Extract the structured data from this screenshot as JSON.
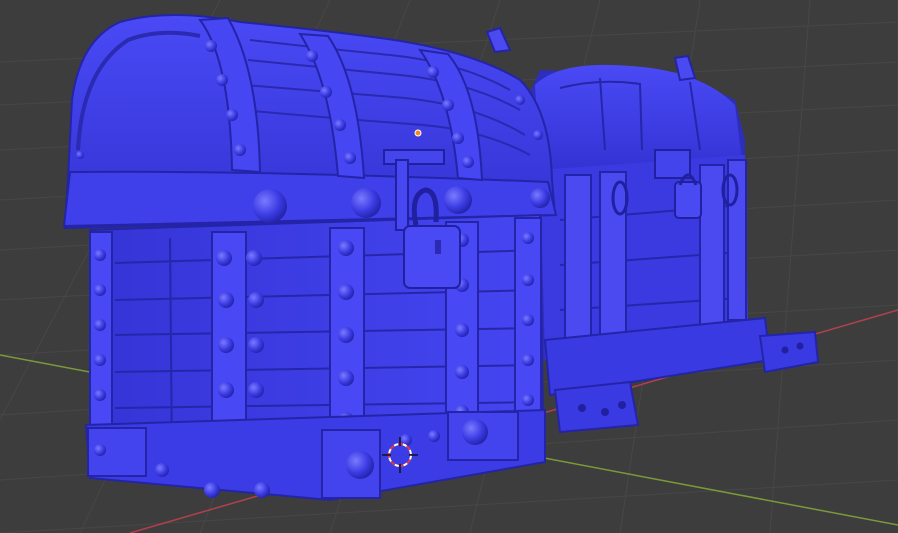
{
  "viewport": {
    "name": "3D Viewport",
    "background": "#3d3d3d",
    "grid_color": "#474747",
    "x_axis_color": "#b1404e",
    "y_axis_color": "#7a9a3a"
  },
  "objects": [
    {
      "name": "treasure-chest-front",
      "material_color": "#3a3ae8",
      "shade_color": "#2424b8",
      "highlight_color": "#6e6efc"
    },
    {
      "name": "treasure-chest-back",
      "material_color": "#3d3ddf",
      "shade_color": "#2a2ab0",
      "highlight_color": "#6565f5"
    }
  ],
  "cursor": {
    "icon": "3d-cursor-icon",
    "ring_color_a": "#e23a3a",
    "ring_color_b": "#ffffff"
  },
  "origin": {
    "icon": "origin-dot-icon",
    "color": "#f08a1e"
  }
}
